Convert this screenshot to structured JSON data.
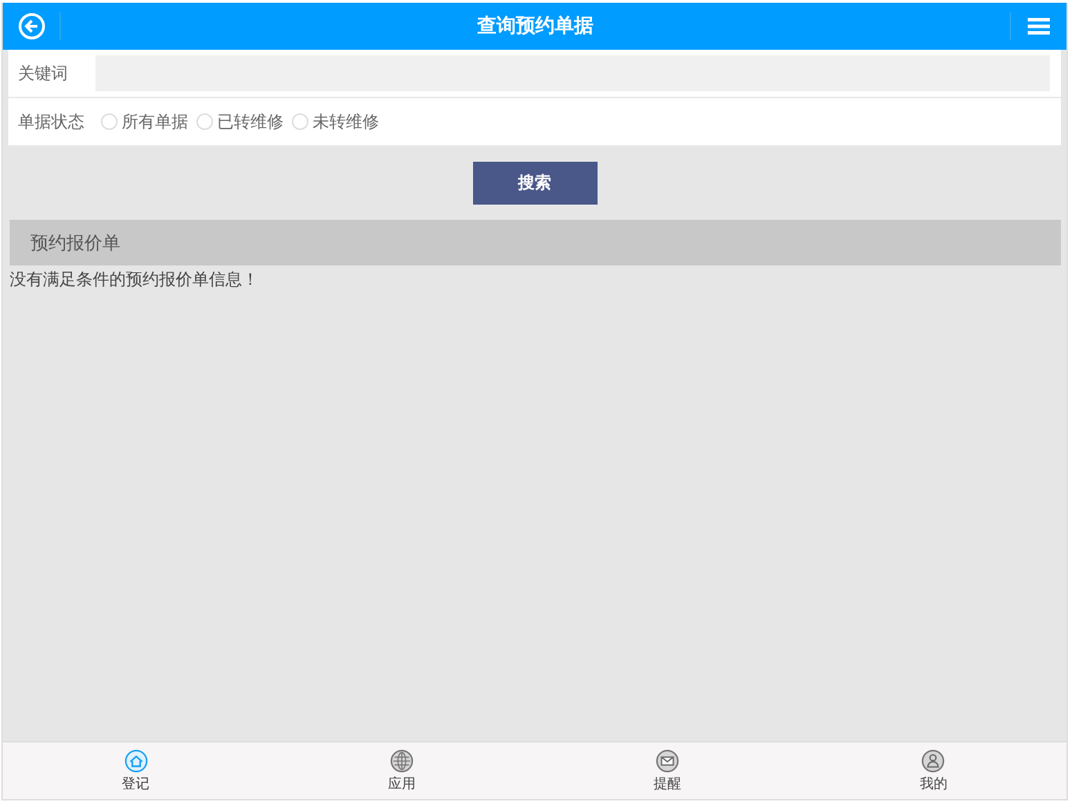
{
  "header": {
    "title": "查询预约单据"
  },
  "keyword": {
    "label": "关键词"
  },
  "status": {
    "label": "单据状态",
    "options": [
      {
        "label": "所有单据",
        "checked": false
      },
      {
        "label": "已转维修",
        "checked": false
      },
      {
        "label": "未转维修",
        "checked": false
      }
    ]
  },
  "search_button": "搜索",
  "section": {
    "title": "预约报价单",
    "empty_message": "没有满足条件的预约报价单信息！"
  },
  "tabbar": [
    {
      "label": "登记",
      "selected": true
    },
    {
      "label": "应用",
      "selected": false
    },
    {
      "label": "提醒",
      "selected": false
    },
    {
      "label": "我的",
      "selected": false
    }
  ]
}
